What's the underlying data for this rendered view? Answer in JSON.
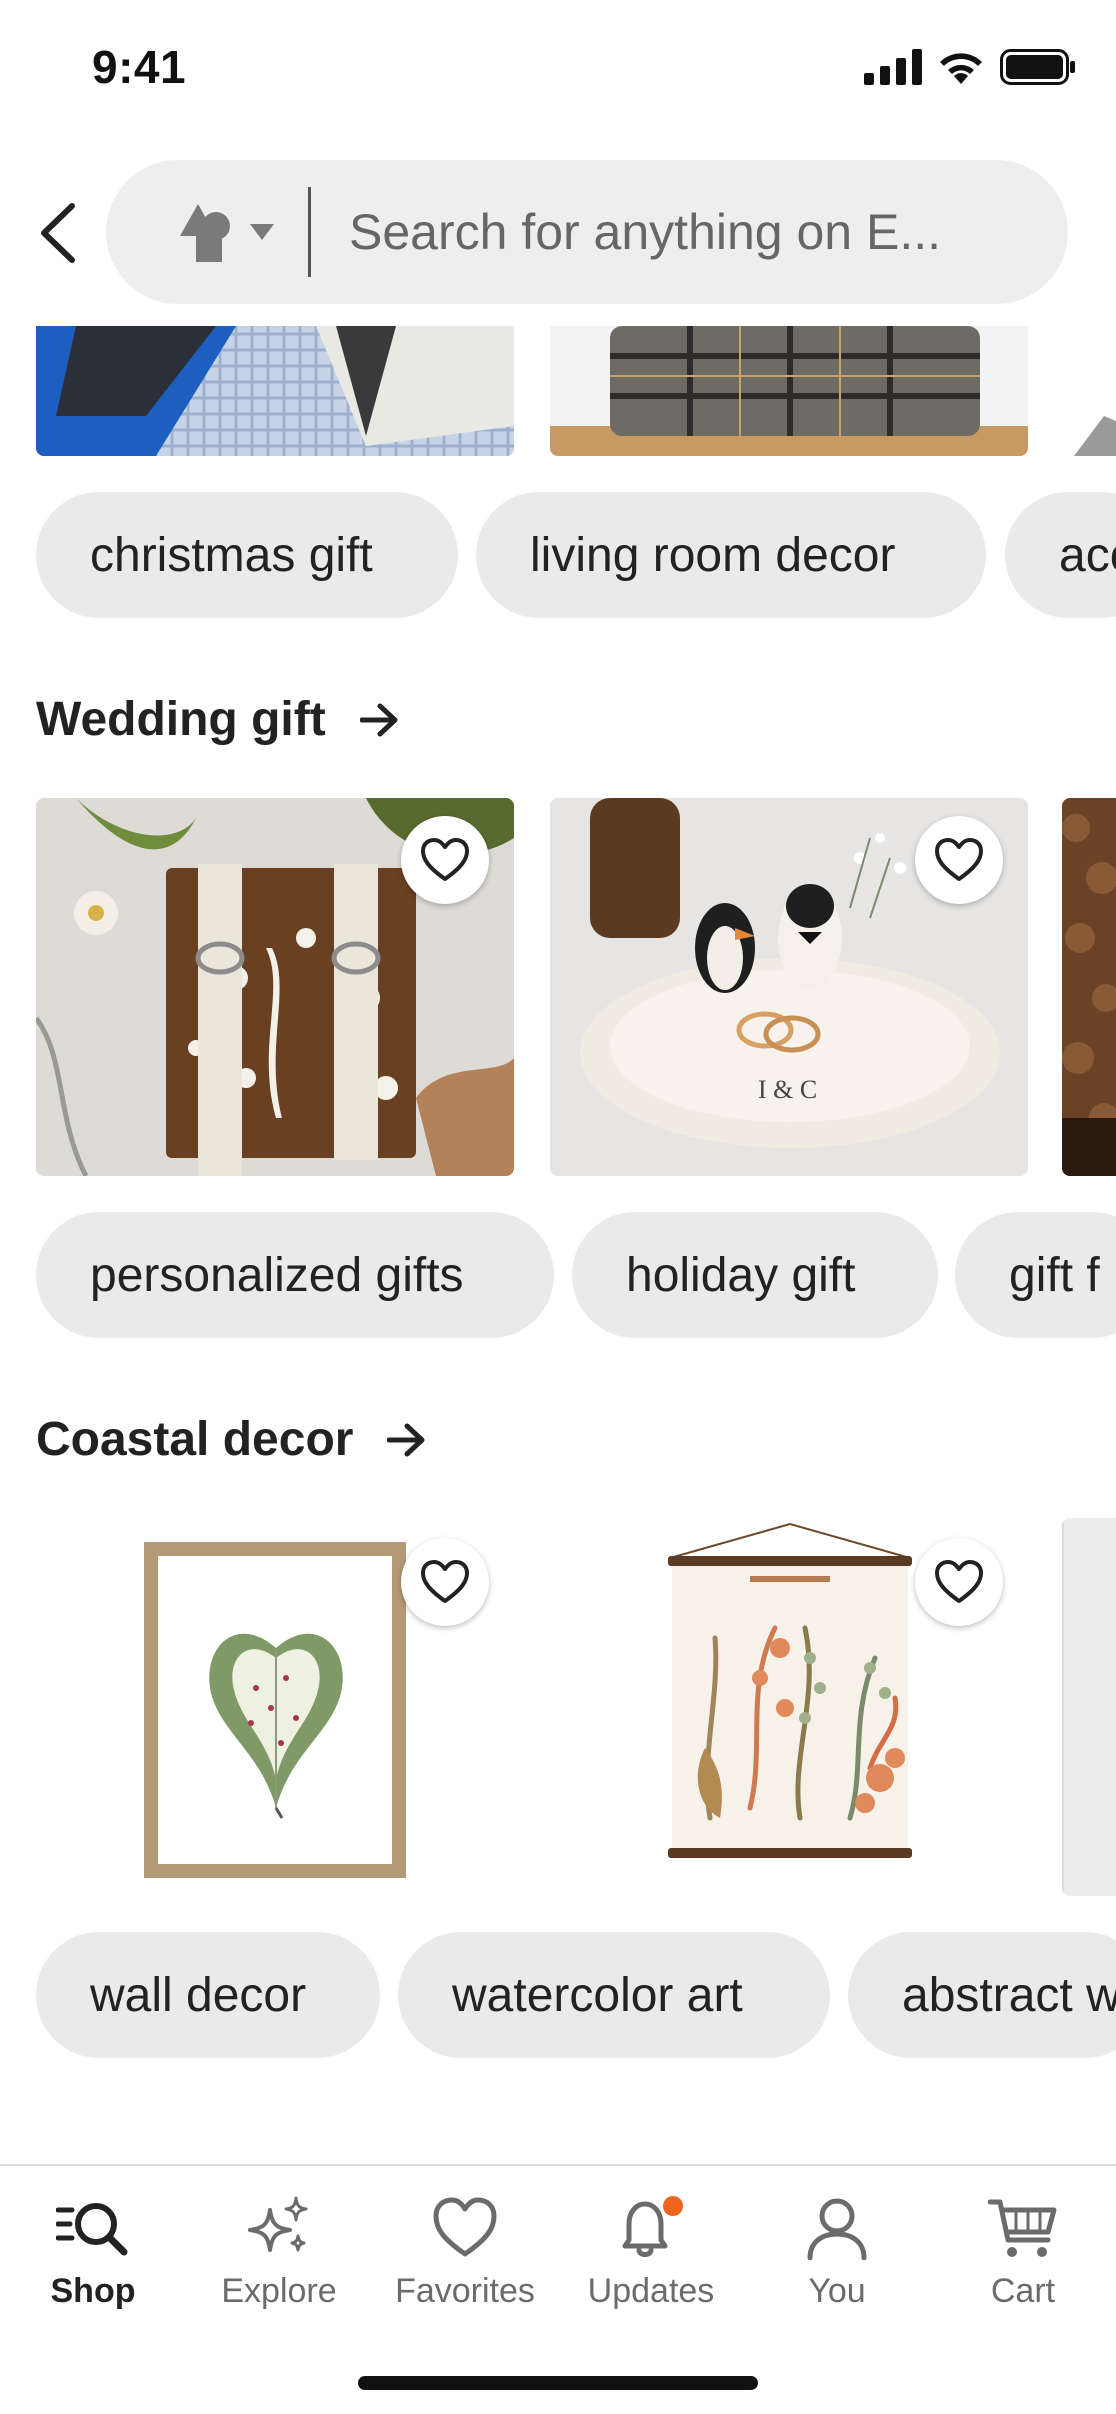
{
  "status_bar": {
    "time": "9:41"
  },
  "search": {
    "placeholder": "Search for anything on E..."
  },
  "top_chips": [
    "christmas gift",
    "living room decor",
    "acc"
  ],
  "sections": [
    {
      "title": "Wedding gift",
      "chips": [
        "personalized gifts",
        "holiday gift",
        "gift f"
      ]
    },
    {
      "title": "Coastal decor",
      "chips": [
        "wall decor",
        "watercolor art",
        "abstract w"
      ]
    }
  ],
  "wedding_items": [
    {
      "image": "pressed botanical wooden cutting board with canvas straps"
    },
    {
      "image": "ceramic ring dish with penguin figurines"
    }
  ],
  "coastal_items": [
    {
      "image": "framed caladium leaf watercolor print"
    },
    {
      "image": "vintage seaweed botanical chart poster"
    }
  ],
  "bottom_nav": {
    "items": [
      {
        "label": "Shop",
        "icon": "shop-search-icon",
        "active": true
      },
      {
        "label": "Explore",
        "icon": "sparkle-icon",
        "active": false
      },
      {
        "label": "Favorites",
        "icon": "heart-icon",
        "active": false
      },
      {
        "label": "Updates",
        "icon": "bell-icon",
        "active": false,
        "badge": true
      },
      {
        "label": "You",
        "icon": "person-icon",
        "active": false
      },
      {
        "label": "Cart",
        "icon": "cart-icon",
        "active": false
      }
    ]
  },
  "colors": {
    "badge": "#f1641e",
    "chip_bg": "#eaeaea",
    "search_bg": "#eeeeee"
  }
}
